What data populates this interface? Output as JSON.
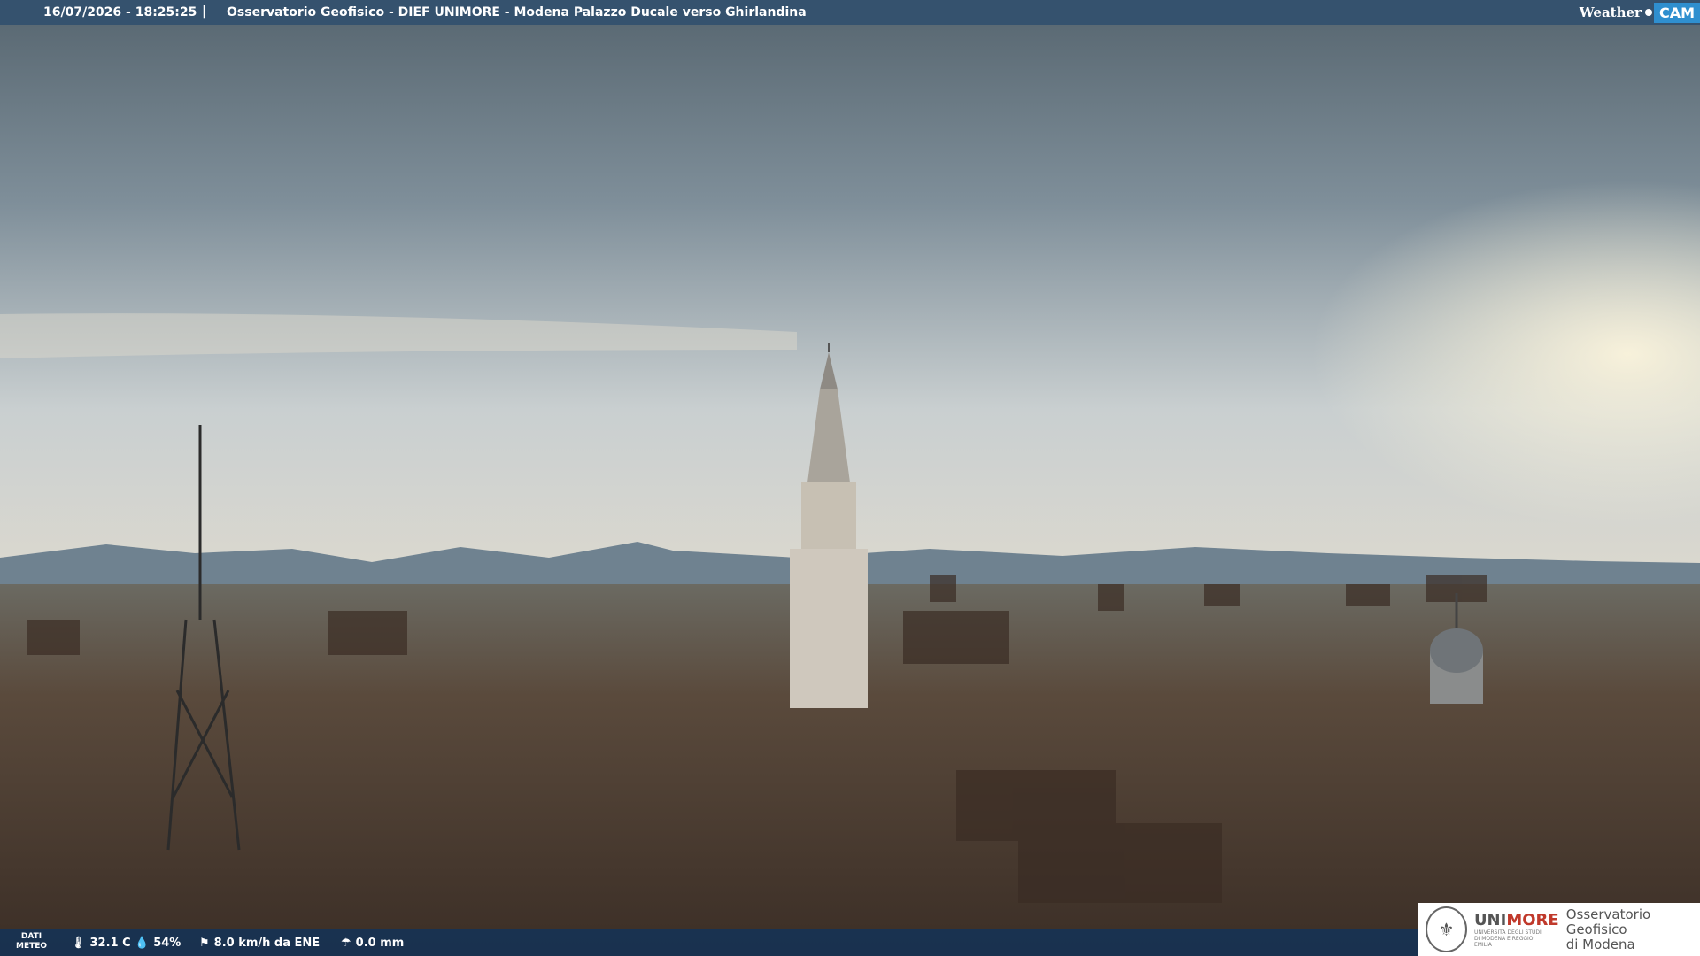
{
  "header": {
    "timestamp": "16/07/2026 - 18:25:25",
    "separator": "|",
    "title": "Osservatorio Geofisico - DIEF UNIMORE - Modena Palazzo Ducale verso Ghirlandina",
    "brand_weather": "Weather",
    "brand_cam": "CAM"
  },
  "footer": {
    "dati_label_1": "DATI",
    "dati_label_2": "METEO",
    "temperature": "32.1 C",
    "humidity": "54%",
    "wind": "8.0 km/h da ENE",
    "rain": "0.0 mm"
  },
  "logo": {
    "uni_prefix": "UNI",
    "uni_suffix": "MORE",
    "uni_sub": "UNIVERSITÀ DEGLI STUDI DI MODENA E REGGIO EMILIA",
    "obs_line1": "Osservatorio Geofisico",
    "obs_line2": "di Modena"
  },
  "colors": {
    "sky_top": "#5f6f7c",
    "sky_mid": "#a9b6c0",
    "sky_glow": "#f3eedb",
    "city": "#4a3a2e",
    "bar": "#32506e"
  }
}
